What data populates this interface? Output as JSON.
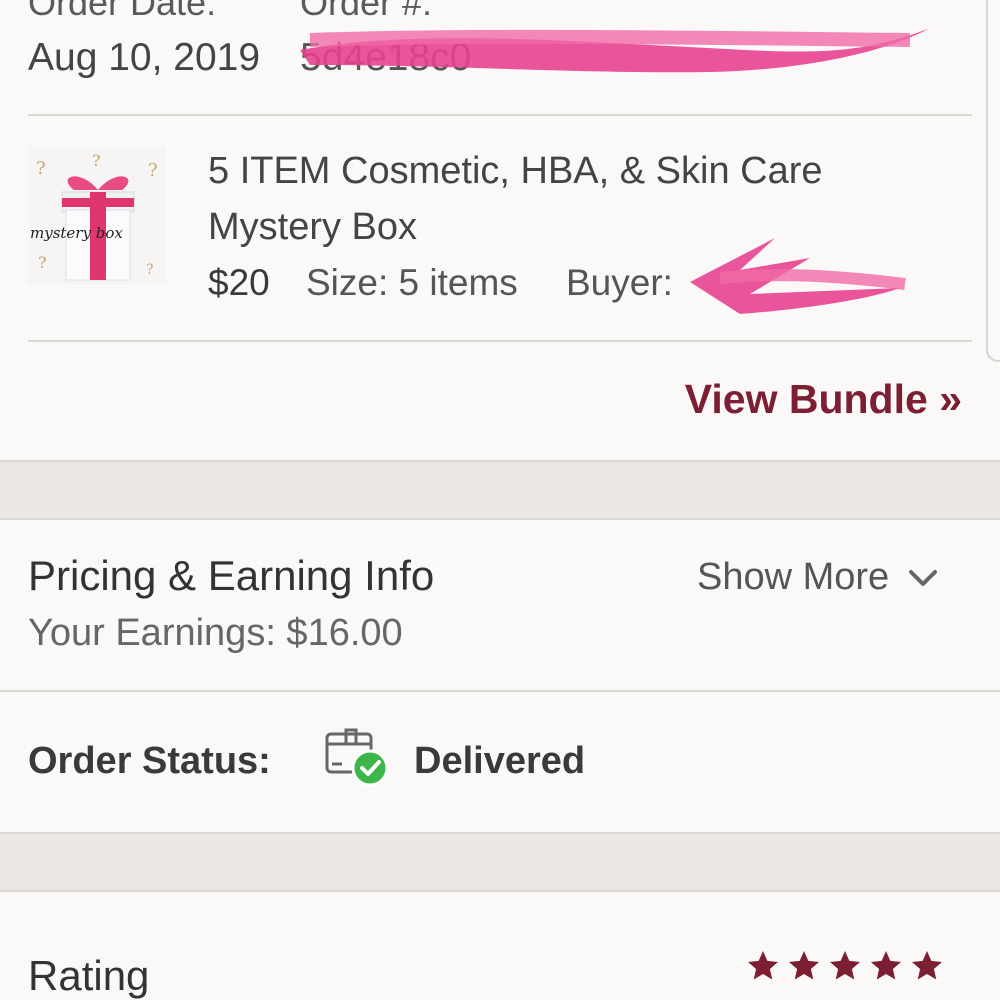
{
  "order": {
    "date_label": "Order Date:",
    "date_value": "Aug 10, 2019",
    "number_label": "Order #:",
    "number_value": "5d4e18c0"
  },
  "item": {
    "title_line1": "5 ITEM Cosmetic, HBA, & Skin Care",
    "title_line2": "Mystery Box",
    "price": "$20",
    "size": "Size: 5 items",
    "buyer_label": "Buyer:",
    "thumbnail_text": "mystery box"
  },
  "view_bundle": "View Bundle »",
  "pricing": {
    "heading": "Pricing & Earning Info",
    "earnings": "Your Earnings: $16.00",
    "show_more": "Show More"
  },
  "status": {
    "label": "Order Status:",
    "value": "Delivered"
  },
  "rating": {
    "heading": "Rating",
    "stars": 5
  },
  "colors": {
    "accent": "#7d1f33",
    "scribble": "#e8418f",
    "success": "#3db54a"
  }
}
